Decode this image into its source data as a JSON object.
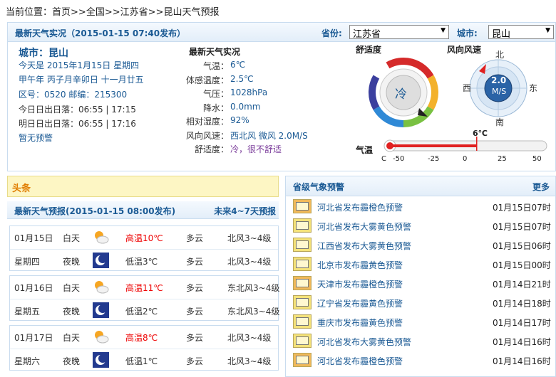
{
  "breadcrumb": {
    "label": "当前位置：",
    "items": [
      "首页",
      "全国",
      "江苏省",
      "昆山天气预报"
    ],
    "sep": ">>"
  },
  "realtime": {
    "title": "最新天气实况（2015-01-15  07:40发布）",
    "province_label": "省份:",
    "province_value": "江苏省",
    "city_label": "城市:",
    "city_value": "昆山",
    "city_line": "城市：昆山",
    "today_line": "今天是 2015年1月15日 星期四",
    "lunar_line": "甲午年 丙子月辛卯日 十一月廿五",
    "code_line": "区号：0520  邮编：215300",
    "sun_today": "今日日出日落：06:55 | 17:15",
    "sun_tomorrow": "明日日出日落：06:55 | 17:16",
    "no_warning": "暂无预警",
    "obs_title": "最新天气实况",
    "obs": [
      {
        "label": "气温：",
        "value": "6℃"
      },
      {
        "label": "体感温度：",
        "value": "2.5℃"
      },
      {
        "label": "气压：",
        "value": "1028hPa"
      },
      {
        "label": "降水：",
        "value": "0.0mm"
      },
      {
        "label": "相对湿度：",
        "value": "92%"
      },
      {
        "label": "风向风速：",
        "value": "西北风 微风 2.0M/S"
      },
      {
        "label": "舒适度：",
        "value": "冷，很不舒适"
      }
    ],
    "comfort": {
      "title": "舒适度",
      "text": "冷"
    },
    "wind": {
      "title": "风向风速",
      "speed": "2.0",
      "unit": "M/S",
      "n": "北",
      "s": "南",
      "e": "东",
      "w": "西"
    },
    "temp": {
      "title": "气温",
      "current": "6℃",
      "value": 6,
      "min": -50,
      "max": 50,
      "c": "C",
      "ticks": [
        "-50",
        "-25",
        "0",
        "25",
        "50"
      ]
    }
  },
  "headline": {
    "tag": "头条"
  },
  "forecast": {
    "title": "最新天气预报(2015-01-15  08:00发布)",
    "more": "未来4~7天预报",
    "days": [
      {
        "date": "01月15日",
        "weekday": "星期四",
        "day": {
          "period": "白天",
          "temp": "高温10℃",
          "weather": "多云",
          "wind": "北风3~4级"
        },
        "night": {
          "period": "夜晚",
          "temp": "低温3℃",
          "weather": "多云",
          "wind": "北风3~4级"
        }
      },
      {
        "date": "01月16日",
        "weekday": "星期五",
        "day": {
          "period": "白天",
          "temp": "高温11℃",
          "weather": "多云",
          "wind": "东北风3~4级"
        },
        "night": {
          "period": "夜晚",
          "temp": "低温2℃",
          "weather": "多云",
          "wind": "东北风3~4级"
        }
      },
      {
        "date": "01月17日",
        "weekday": "星期六",
        "day": {
          "period": "白天",
          "temp": "高温8℃",
          "weather": "多云",
          "wind": "北风3~4级"
        },
        "night": {
          "period": "夜晚",
          "temp": "低温1℃",
          "weather": "多云",
          "wind": "北风3~4级"
        }
      }
    ]
  },
  "warnings": {
    "title": "省级气象预警",
    "more": "更多",
    "items": [
      {
        "text": "河北省发布霾橙色预警",
        "time": "01月15日07时",
        "color": "orange"
      },
      {
        "text": "河北省发布大雾黄色预警",
        "time": "01月15日07时",
        "color": "yellow"
      },
      {
        "text": "江西省发布大雾黄色预警",
        "time": "01月15日06时",
        "color": "yellow"
      },
      {
        "text": "北京市发布霾黄色预警",
        "time": "01月15日00时",
        "color": "yellow"
      },
      {
        "text": "天津市发布霾橙色预警",
        "time": "01月14日21时",
        "color": "orange"
      },
      {
        "text": "辽宁省发布霾黄色预警",
        "time": "01月14日18时",
        "color": "yellow"
      },
      {
        "text": "重庆市发布霾黄色预警",
        "time": "01月14日17时",
        "color": "yellow"
      },
      {
        "text": "河北省发布大雾黄色预警",
        "time": "01月14日16时",
        "color": "yellow"
      },
      {
        "text": "河北省发布霾橙色预警",
        "time": "01月14日16时",
        "color": "orange"
      }
    ]
  }
}
